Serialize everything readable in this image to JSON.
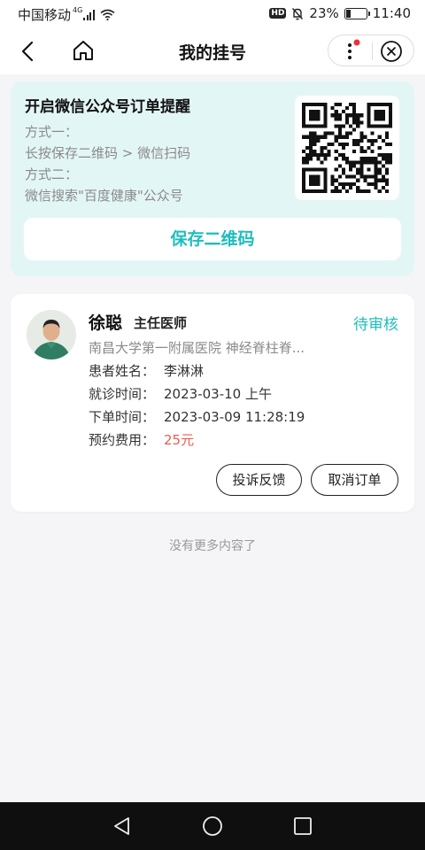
{
  "status_bar": {
    "carrier": "中国移动",
    "network": "4G",
    "battery": "23%",
    "battery_level": 0.23,
    "time": "11:40",
    "hd_label": "HD"
  },
  "nav": {
    "title": "我的挂号",
    "icons": [
      "back-icon",
      "home-icon",
      "more-icon",
      "close-icon"
    ],
    "notify_dot_color": "#e8323c"
  },
  "subscribe": {
    "title": "开启微信公众号订单提醒",
    "lines": [
      "方式一：",
      "长按保存二维码 > 微信扫码",
      "方式二：",
      "微信搜索\"百度健康\"公众号"
    ],
    "save_button": "保存二维码"
  },
  "order": {
    "doctor_name": "徐聪",
    "doctor_title": "主任医师",
    "status": "待审核",
    "hospital": "南昌大学第一附属医院 神经脊柱脊...",
    "fields": [
      {
        "label": "患者姓名：",
        "value": "李淋淋"
      },
      {
        "label": "就诊时间：",
        "value": "2023-03-10 上午"
      },
      {
        "label": "下单时间：",
        "value": "2023-03-09 11:28:19"
      },
      {
        "label": "预约费用：",
        "value": "25元"
      }
    ],
    "buttons": {
      "complaint": "投诉反馈",
      "cancel": "取消订单"
    }
  },
  "footer": {
    "no_more": "没有更多内容了"
  },
  "colors": {
    "accent": "#1fbdbd",
    "fee": "#ef5a4c",
    "card_tint": "#e3f6f6"
  }
}
